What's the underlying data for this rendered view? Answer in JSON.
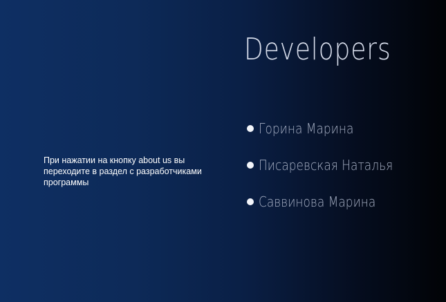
{
  "caption": "При нажатии на кнопку about us вы переходите в раздел с разработчиками программы",
  "developers": {
    "title": "Developers",
    "items": [
      {
        "name": "Горина Марина"
      },
      {
        "name": "Писаревская Наталья"
      },
      {
        "name": "Саввинова Марина"
      }
    ]
  },
  "colors": {
    "background_left": "#0e2f63",
    "background_right": "#010306",
    "title": "#d6dcea",
    "names": "#a6afc3",
    "bullet": "#f3f5fa"
  }
}
